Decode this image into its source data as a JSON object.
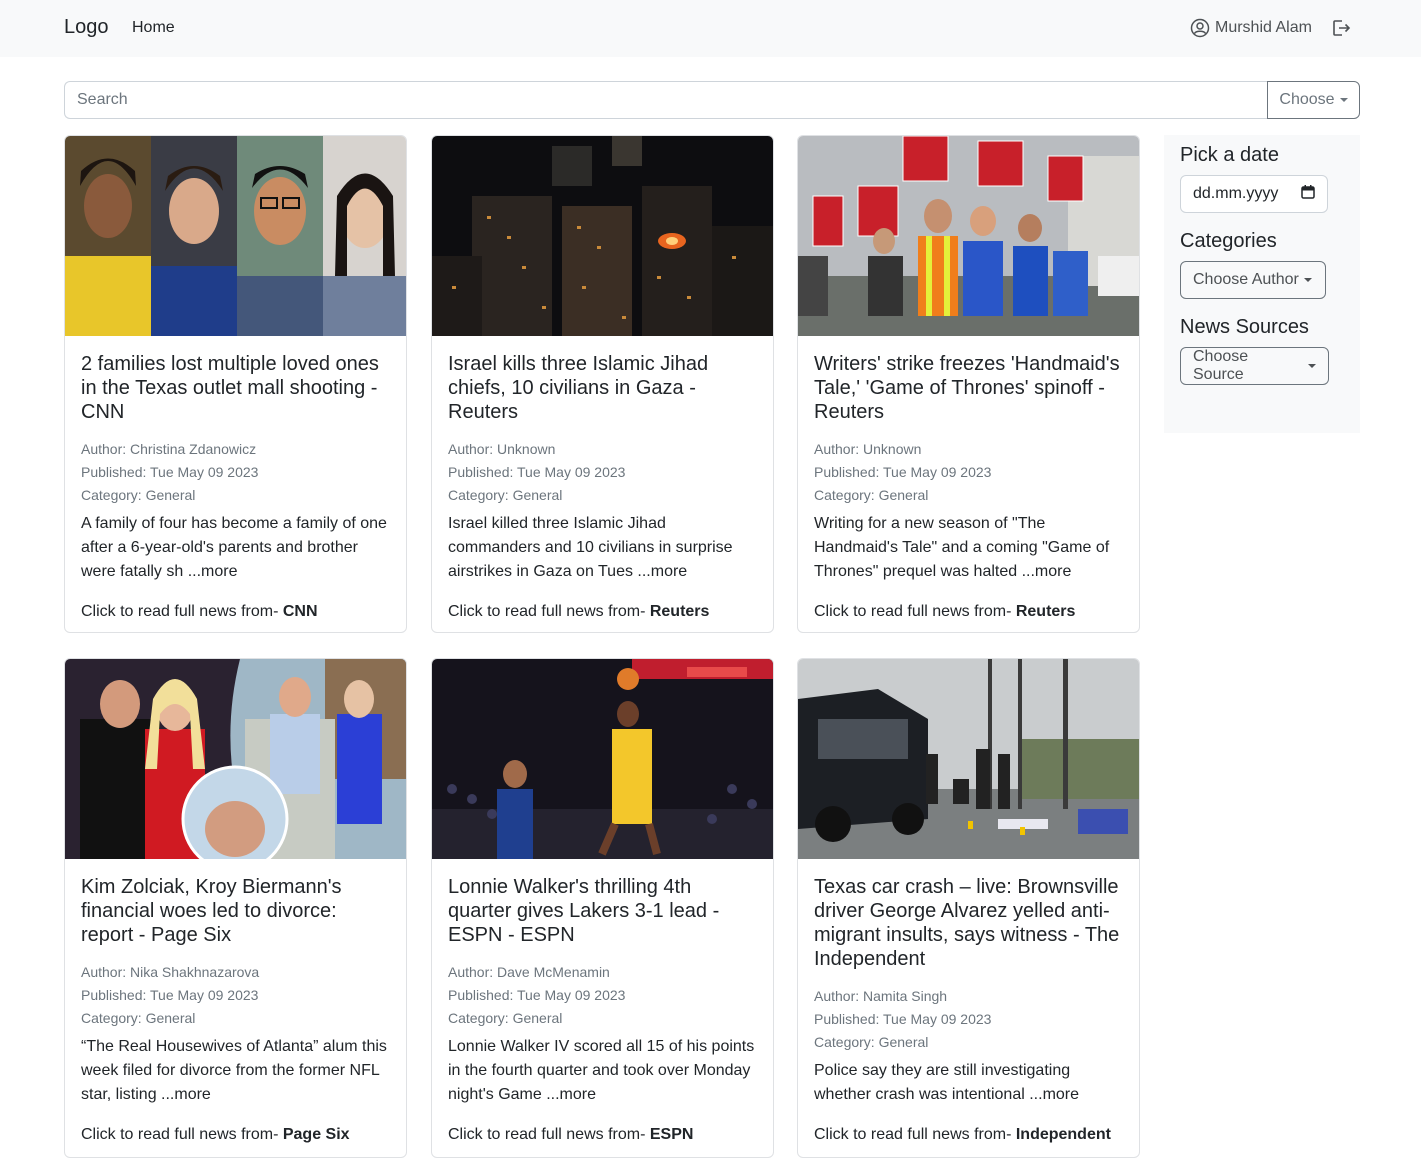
{
  "navbar": {
    "brand": "Logo",
    "home": "Home",
    "user_name": "Murshid Alam",
    "user_icon": "person-circle-icon",
    "logout_icon": "logout-icon"
  },
  "search": {
    "placeholder": "Search",
    "choose_label": "Choose"
  },
  "sidebar": {
    "date_heading": "Pick a date",
    "date_placeholder": "dd.mm.yyyy",
    "categories_heading": "Categories",
    "author_button": "Choose Author",
    "sources_heading": "News Sources",
    "source_button": "Choose Source"
  },
  "cards": [
    {
      "title": "2 families lost multiple loved ones in the Texas outlet mall shooting - CNN",
      "author": "Author: Christina Zdanowicz",
      "published": "Published: Tue May 09 2023",
      "category": "Category: General",
      "description": "A family of four has become a family of one after a 6-year-old's parents and brother were fatally sh ...more",
      "read_prefix": "Click to read full news from- ",
      "source": "CNN"
    },
    {
      "title": "Israel kills three Islamic Jihad chiefs, 10 civilians in Gaza - Reuters",
      "author": "Author: Unknown",
      "published": "Published: Tue May 09 2023",
      "category": "Category: General",
      "description": "Israel killed three Islamic Jihad commanders and 10 civilians in surprise airstrikes in Gaza on Tues ...more",
      "read_prefix": "Click to read full news from- ",
      "source": "Reuters"
    },
    {
      "title": "Writers' strike freezes 'Handmaid's Tale,' 'Game of Thrones' spinoff - Reuters",
      "author": "Author: Unknown",
      "published": "Published: Tue May 09 2023",
      "category": "Category: General",
      "description": "Writing for a new season of \"The Handmaid's Tale\" and a coming \"Game of Thrones\" prequel was halted ...more",
      "read_prefix": "Click to read full news from- ",
      "source": "Reuters"
    },
    {
      "title": "Kim Zolciak, Kroy Biermann's financial woes led to divorce: report - Page Six",
      "author": "Author: Nika Shakhnazarova",
      "published": "Published: Tue May 09 2023",
      "category": "Category: General",
      "description": "“The Real Housewives of Atlanta” alum this week filed for divorce from the former NFL star, listing ...more",
      "read_prefix": "Click to read full news from- ",
      "source": "Page Six"
    },
    {
      "title": "Lonnie Walker's thrilling 4th quarter gives Lakers 3-1 lead - ESPN - ESPN",
      "author": "Author: Dave McMenamin",
      "published": "Published: Tue May 09 2023",
      "category": "Category: General",
      "description": "Lonnie Walker IV scored all 15 of his points in the fourth quarter and took over Monday night's Game ...more",
      "read_prefix": "Click to read full news from- ",
      "source": "ESPN"
    },
    {
      "title": "Texas car crash – live: Brownsville driver George Alvarez yelled anti-migrant insults, says witness - The Independent",
      "author": "Author: Namita Singh",
      "published": "Published: Tue May 09 2023",
      "category": "Category: General",
      "description": "Police say they are still investigating whether crash was intentional ...more",
      "read_prefix": "Click to read full news from- ",
      "source": "Independent"
    }
  ]
}
